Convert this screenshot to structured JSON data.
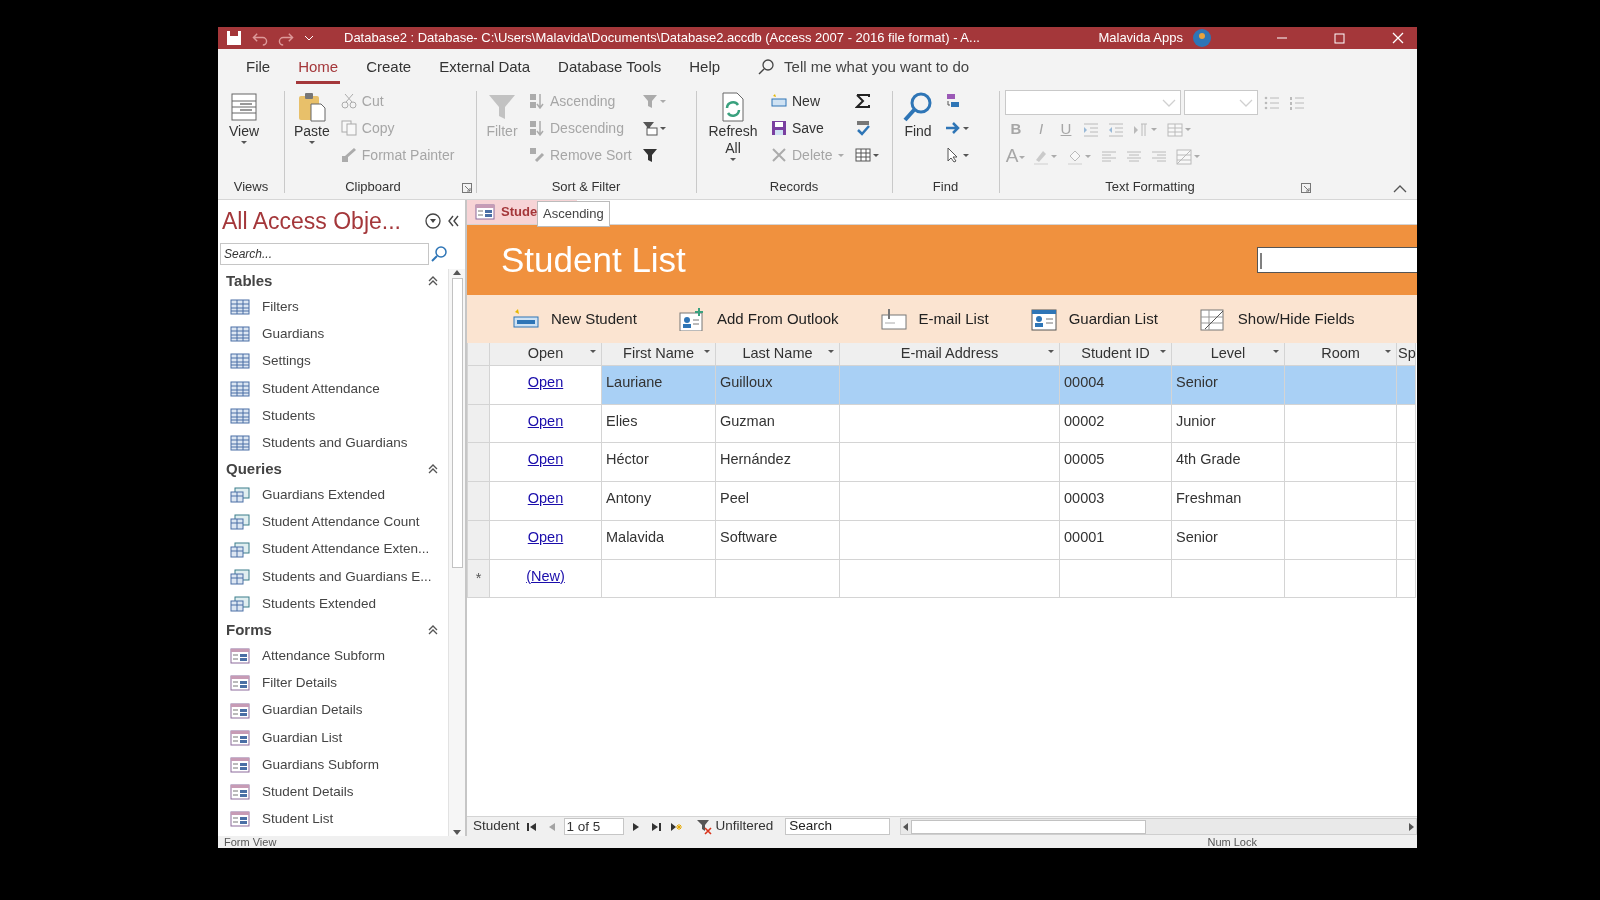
{
  "title_bar": {
    "title": "Database2 : Database- C:\\Users\\Malavida\\Documents\\Database2.accdb (Access 2007 - 2016 file format)  -  A...",
    "account": "Malavida Apps"
  },
  "menu_tabs": [
    {
      "label": "File",
      "selected": false
    },
    {
      "label": "Home",
      "selected": true
    },
    {
      "label": "Create",
      "selected": false
    },
    {
      "label": "External Data",
      "selected": false
    },
    {
      "label": "Database Tools",
      "selected": false
    },
    {
      "label": "Help",
      "selected": false
    }
  ],
  "tell_me": {
    "placeholder": "Tell me what you want to do"
  },
  "ribbon_groups": [
    {
      "label": "Views",
      "buttons": [
        {
          "kind": "large",
          "label": "View",
          "disabled": false
        }
      ]
    },
    {
      "label": "Clipboard",
      "launcher": true,
      "buttons": [
        {
          "kind": "large",
          "label": "Paste",
          "disabled": false
        },
        {
          "kind": "small",
          "label": "Cut",
          "disabled": true
        },
        {
          "kind": "small",
          "label": "Copy",
          "disabled": true
        },
        {
          "kind": "small",
          "label": "Format Painter",
          "disabled": true
        }
      ]
    },
    {
      "label": "Sort & Filter",
      "buttons": [
        {
          "kind": "large",
          "label": "Filter",
          "disabled": true
        },
        {
          "kind": "small",
          "label": "Ascending",
          "disabled": true
        },
        {
          "kind": "small",
          "label": "Descending",
          "disabled": true
        },
        {
          "kind": "small",
          "label": "Remove Sort",
          "disabled": true
        },
        {
          "kind": "icon",
          "disabled": true
        },
        {
          "kind": "icon",
          "disabled": false
        },
        {
          "kind": "icon",
          "disabled": false
        }
      ]
    },
    {
      "label": "Records",
      "buttons": [
        {
          "kind": "large",
          "label": "Refresh All",
          "disabled": false
        },
        {
          "kind": "small",
          "label": "New",
          "disabled": false
        },
        {
          "kind": "small",
          "label": "Save",
          "disabled": false
        },
        {
          "kind": "small",
          "label": "Delete",
          "disabled": true
        },
        {
          "kind": "icon",
          "disabled": false
        },
        {
          "kind": "icon",
          "disabled": false
        },
        {
          "kind": "icon",
          "disabled": false
        }
      ]
    },
    {
      "label": "Find",
      "buttons": [
        {
          "kind": "large",
          "label": "Find",
          "disabled": false
        },
        {
          "kind": "icon",
          "disabled": false
        },
        {
          "kind": "icon",
          "disabled": false
        },
        {
          "kind": "icon",
          "disabled": false
        }
      ]
    },
    {
      "label": "Text Formatting",
      "launcher": true,
      "rows": [
        [
          {
            "kind": "combo",
            "disabled": true
          },
          {
            "kind": "combo",
            "disabled": true
          },
          {
            "kind": "icon",
            "disabled": true
          },
          {
            "kind": "icon",
            "disabled": true
          }
        ],
        [
          {
            "kind": "letter",
            "label": "B",
            "disabled": true
          },
          {
            "kind": "letter",
            "label": "I",
            "disabled": true
          },
          {
            "kind": "letter",
            "label": "U",
            "disabled": true
          },
          {
            "kind": "icon",
            "disabled": true
          },
          {
            "kind": "icon",
            "disabled": true
          },
          {
            "kind": "icon",
            "disabled": true
          },
          {
            "kind": "icon",
            "disabled": true
          }
        ],
        [
          {
            "kind": "letter",
            "label": "A",
            "disabled": true
          },
          {
            "kind": "icon",
            "disabled": true
          },
          {
            "kind": "icon",
            "disabled": true
          },
          {
            "kind": "icon",
            "disabled": true
          },
          {
            "kind": "icon",
            "disabled": true
          },
          {
            "kind": "icon",
            "disabled": true
          },
          {
            "kind": "icon",
            "disabled": true
          }
        ]
      ]
    }
  ],
  "nav_pane": {
    "title": "All Access Obje...",
    "search": {
      "placeholder": "Search..."
    },
    "sections": [
      {
        "label": "Tables",
        "kind": "table",
        "expanded": true,
        "items": [
          "Filters",
          "Guardians",
          "Settings",
          "Student Attendance",
          "Students",
          "Students and Guardians"
        ]
      },
      {
        "label": "Queries",
        "kind": "query",
        "expanded": true,
        "items": [
          "Guardians Extended",
          "Student Attendance Count",
          "Student Attendance Exten...",
          "Students and Guardians E...",
          "Students Extended"
        ]
      },
      {
        "label": "Forms",
        "kind": "form",
        "expanded": true,
        "items": [
          "Attendance Subform",
          "Filter Details",
          "Guardian Details",
          "Guardian List",
          "Guardians Subform",
          "Student Details",
          "Student List"
        ]
      }
    ]
  },
  "document_tab": {
    "label": "Stude"
  },
  "tooltip": {
    "text": "Ascending"
  },
  "form": {
    "title": "Student List"
  },
  "toolbar": [
    {
      "label": "New Student"
    },
    {
      "label": "Add From Outlook"
    },
    {
      "label": "E-mail List"
    },
    {
      "label": "Guardian List"
    },
    {
      "label": "Show/Hide Fields"
    }
  ],
  "table": {
    "columns": [
      {
        "label": "Open",
        "filter": true
      },
      {
        "label": "First Name",
        "filter": true
      },
      {
        "label": "Last Name",
        "filter": true
      },
      {
        "label": "E-mail Address",
        "filter": true
      },
      {
        "label": "Student ID",
        "filter": true
      },
      {
        "label": "Level",
        "filter": true
      },
      {
        "label": "Room",
        "filter": true
      },
      {
        "label": "Sp",
        "filter": false
      }
    ],
    "rows": [
      {
        "kind": "record",
        "selected": true,
        "open_link": "Open",
        "first_name": "Lauriane",
        "last_name": "Guilloux",
        "student_id": "00004",
        "level": "Senior"
      },
      {
        "kind": "record",
        "selected": false,
        "open_link": "Open",
        "first_name": "Elies",
        "last_name": "Guzman",
        "student_id": "00002",
        "level": "Junior"
      },
      {
        "kind": "record",
        "selected": false,
        "open_link": "Open",
        "first_name": "Héctor",
        "last_name": "Hernández",
        "student_id": "00005",
        "level": "4th Grade"
      },
      {
        "kind": "record",
        "selected": false,
        "open_link": "Open",
        "first_name": "Antony",
        "last_name": "Peel",
        "student_id": "00003",
        "level": "Freshman"
      },
      {
        "kind": "record",
        "selected": false,
        "open_link": "Open",
        "first_name": "Malavida",
        "last_name": "Software",
        "student_id": "00001",
        "level": "Senior"
      },
      {
        "kind": "new",
        "selected": false,
        "selector": "*",
        "open_link": "(New)"
      }
    ]
  },
  "record_nav": {
    "label": "Student",
    "position": "1 of 5",
    "filter": "Unfiltered",
    "search": {
      "placeholder": "Search"
    }
  },
  "status_bar": {
    "left": "Form View",
    "right": "Num Lock"
  }
}
